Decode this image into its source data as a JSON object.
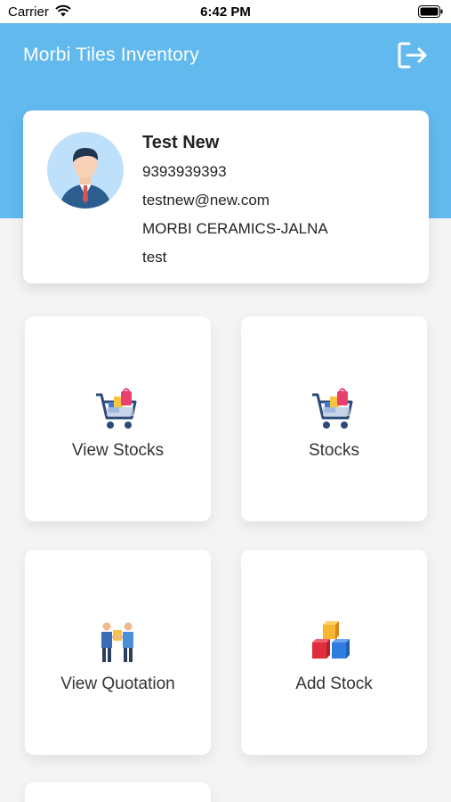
{
  "status_bar": {
    "carrier": "Carrier",
    "time": "6:42 PM"
  },
  "header": {
    "title": "Morbi Tiles Inventory",
    "logout_icon": "logout-icon",
    "color": "#62b9ee"
  },
  "profile": {
    "name": "Test New",
    "phone": "9393939393",
    "email": "testnew@new.com",
    "company": "MORBI CERAMICS-JALNA",
    "extra": "test",
    "avatar_icon": "businessman-avatar"
  },
  "menu": [
    {
      "label": "View Stocks",
      "icon": "shopping-cart-icon"
    },
    {
      "label": "Stocks",
      "icon": "shopping-cart-icon"
    },
    {
      "label": "View Quotation",
      "icon": "people-exchange-icon"
    },
    {
      "label": "Add Stock",
      "icon": "boxes-icon"
    }
  ]
}
